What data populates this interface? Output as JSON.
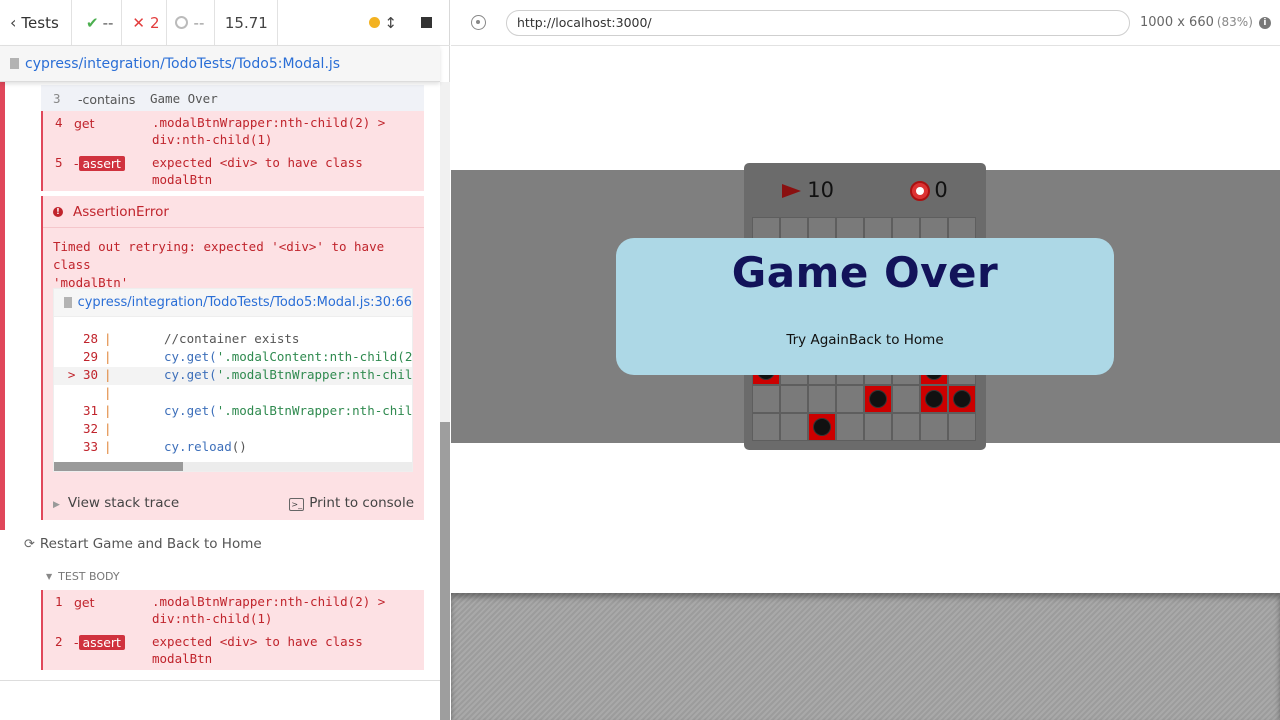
{
  "stats": {
    "tests_label": "Tests",
    "passed": "--",
    "failed": "2",
    "pending": "--",
    "duration": "15.71"
  },
  "spec": {
    "path": "cypress/integration/TodoTests/Todo5:Modal.js"
  },
  "commands": [
    {
      "num": "3",
      "name": "-contains",
      "message": "Game Over"
    },
    {
      "num": "4",
      "name": "get",
      "message_l1": ".modalBtnWrapper:nth-child(2) >",
      "message_l2": "div:nth-child(1)"
    },
    {
      "num": "5",
      "name": "-",
      "badge": "assert",
      "message_l1": "expected <div> to have class",
      "message_l2": "modalBtn"
    }
  ],
  "error": {
    "title": "AssertionError",
    "message_l1": "Timed out retrying: expected '<div>' to have class",
    "message_l2": "'modalBtn'",
    "file": "cypress/integration/TodoTests/Todo5:Modal.js:30:66",
    "code": [
      {
        "ln": "28",
        "bar": "|",
        "src": "//container exists",
        "kind": "comment"
      },
      {
        "ln": "29",
        "bar": "|",
        "fn": "cy.get(",
        "str": "'.modalContent:nth-child(2",
        "kind": "code"
      },
      {
        "ln": "> 30",
        "bar": "|",
        "fn": "cy.get(",
        "str": "'.modalBtnWrapper:nth-chil",
        "kind": "code"
      },
      {
        "ln": "",
        "bar": "|",
        "kind": "empty"
      },
      {
        "ln": "31",
        "bar": "|",
        "fn": "cy.get(",
        "str": "'.modalBtnWrapper:nth-chil",
        "kind": "code"
      },
      {
        "ln": "32",
        "bar": "|",
        "kind": "empty"
      },
      {
        "ln": "33",
        "bar": "|",
        "fn": "cy.reload",
        "str": "()",
        "kind": "reload"
      }
    ],
    "view_stack": "View stack trace",
    "print_console": "Print to console"
  },
  "test2": {
    "title": "Restart Game and Back to Home",
    "body_label": "TEST BODY",
    "commands": [
      {
        "num": "1",
        "name": "get",
        "message_l1": ".modalBtnWrapper:nth-child(2) >",
        "message_l2": "div:nth-child(1)"
      },
      {
        "num": "2",
        "name": "-",
        "badge": "assert",
        "message_l1": "expected <div> to have class",
        "message_l2": "modalBtn"
      }
    ]
  },
  "aut": {
    "url": "http://localhost:3000/",
    "viewport": "1000 x 660",
    "zoom": "(83%)",
    "flags": "10",
    "timer": "0",
    "modal_title": "Game Over",
    "btn_try": "Try Again",
    "btn_home": "Back to Home"
  },
  "colors": {
    "fail": "#e0475a",
    "pass": "#4caf50",
    "link": "#2a6ed6",
    "modal_bg": "#add8e6",
    "modal_title": "#12135a"
  },
  "icons": [
    "chevron-left-icon",
    "check-icon",
    "x-icon",
    "pending-ring-icon",
    "status-dot-icon",
    "arrows-vertical-icon",
    "stop-icon",
    "file-icon",
    "error-icon",
    "terminal-icon",
    "retry-icon",
    "crosshair-icon",
    "info-icon",
    "flag-icon",
    "alarm-clock-icon",
    "bomb-icon"
  ]
}
